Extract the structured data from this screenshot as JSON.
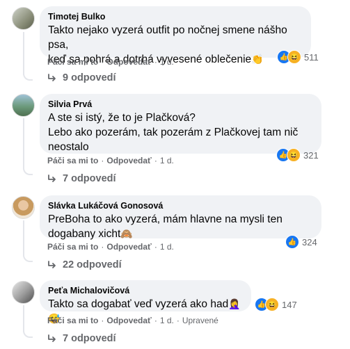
{
  "comments": [
    {
      "author": "Timotej Bulko",
      "lines": [
        "Takto nejako vyzerá outfit po nočnej smene nášho psa,",
        "keď sa pohrá a dotrhá vyvesené oblečenie"
      ],
      "emoji": "👏",
      "reactions": [
        "like",
        "haha"
      ],
      "reaction_count": "511",
      "like_label": "Páči sa mi to",
      "reply_label": "Odpovedať",
      "time": "1 d.",
      "edited": "",
      "replies_label": "9 odpovedí"
    },
    {
      "author": "Silvia Prvá",
      "lines": [
        "A ste si istý, že to je Plačková?",
        "Lebo ako pozerám, tak pozerám z Plačkovej tam nič",
        "neostalo"
      ],
      "emoji": "",
      "reactions": [
        "like",
        "haha"
      ],
      "reaction_count": "321",
      "like_label": "Páči sa mi to",
      "reply_label": "Odpovedať",
      "time": "1 d.",
      "edited": "",
      "replies_label": "7 odpovedí"
    },
    {
      "author": "Slávka Lukáčová Gonosová",
      "lines": [
        "PreBoha to ako vyzerá, mám hlavne na mysli ten",
        "dogabany xicht"
      ],
      "emoji": "🙈",
      "reactions": [
        "like"
      ],
      "reaction_count": "324",
      "like_label": "Páči sa mi to",
      "reply_label": "Odpovedať",
      "time": "1 d.",
      "edited": "",
      "replies_label": "22 odpovedí"
    },
    {
      "author": "Peťa Michalovičová",
      "lines": [
        "Takto sa dogabať veď vyzerá ako had"
      ],
      "emoji": "🤦‍♀️😅",
      "reactions": [
        "like",
        "haha"
      ],
      "reaction_count": "147",
      "like_label": "Páči sa mi to",
      "reply_label": "Odpovedať",
      "time": "1 d.",
      "edited": "Upravené",
      "replies_label": "7 odpovedí"
    }
  ],
  "colors": {
    "bubble": "#f0f2f5",
    "like": "#1877f2",
    "haha": "#f7b125",
    "meta": "#65676b"
  }
}
